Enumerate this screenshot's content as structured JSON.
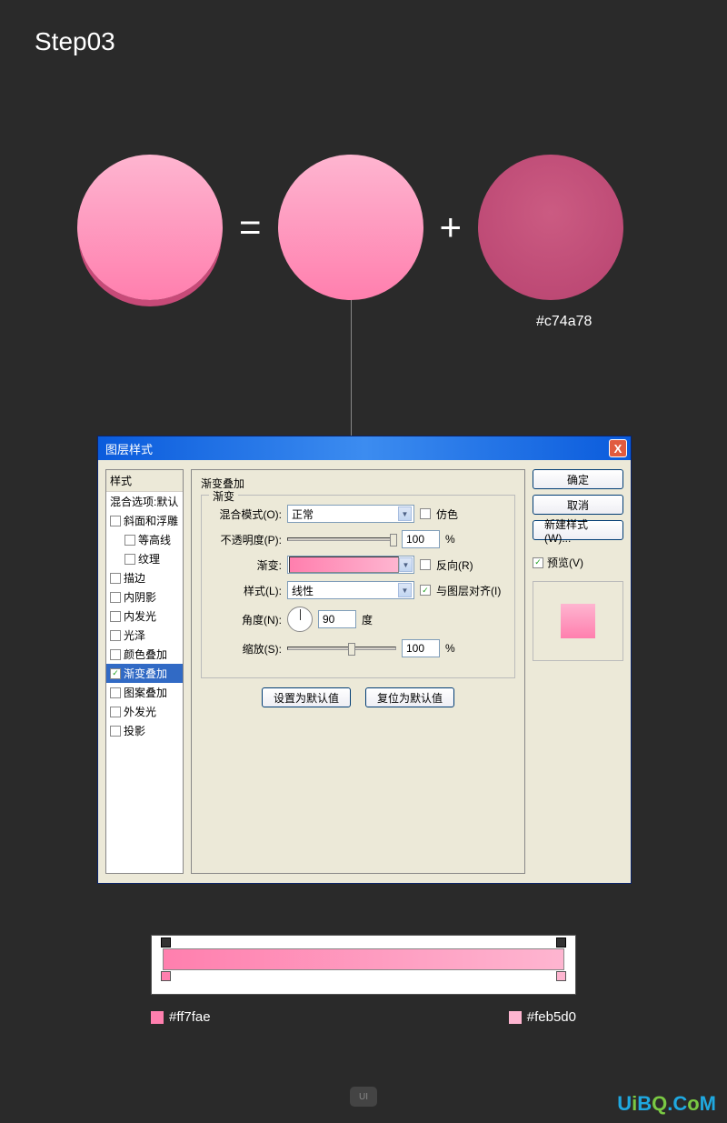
{
  "step_title": "Step03",
  "equation": {
    "equals": "=",
    "plus": "+"
  },
  "circle3_hex": "#c74a78",
  "dialog": {
    "title": "图层样式",
    "close": "X",
    "styles_header": "样式",
    "blend_options": "混合选项:默认",
    "items": [
      {
        "label": "斜面和浮雕",
        "indent": false,
        "checked": false
      },
      {
        "label": "等高线",
        "indent": true,
        "checked": false
      },
      {
        "label": "纹理",
        "indent": true,
        "checked": false
      },
      {
        "label": "描边",
        "indent": false,
        "checked": false
      },
      {
        "label": "内阴影",
        "indent": false,
        "checked": false
      },
      {
        "label": "内发光",
        "indent": false,
        "checked": false
      },
      {
        "label": "光泽",
        "indent": false,
        "checked": false
      },
      {
        "label": "颜色叠加",
        "indent": false,
        "checked": false
      },
      {
        "label": "渐变叠加",
        "indent": false,
        "checked": true,
        "selected": true
      },
      {
        "label": "图案叠加",
        "indent": false,
        "checked": false
      },
      {
        "label": "外发光",
        "indent": false,
        "checked": false
      },
      {
        "label": "投影",
        "indent": false,
        "checked": false
      }
    ],
    "group_title": "渐变叠加",
    "fieldset_label": "渐变",
    "labels": {
      "blend_mode": "混合模式(O):",
      "opacity": "不透明度(P):",
      "gradient": "渐变:",
      "style": "样式(L):",
      "angle": "角度(N):",
      "scale": "缩放(S):"
    },
    "values": {
      "blend_mode": "正常",
      "dither": "仿色",
      "opacity": "100",
      "opacity_unit": "%",
      "reverse": "反向(R)",
      "style": "线性",
      "align": "与图层对齐(I)",
      "angle": "90",
      "angle_unit": "度",
      "scale": "100",
      "scale_unit": "%"
    },
    "buttons": {
      "set_default": "设置为默认值",
      "reset_default": "复位为默认值",
      "ok": "确定",
      "cancel": "取消",
      "new_style": "新建样式(W)...",
      "preview": "预览(V)"
    }
  },
  "gradient_stops": {
    "left_hex": "#ff7fae",
    "right_hex": "#feb5d0"
  },
  "footer": {
    "ui_logo": "UI",
    "brand": {
      "u": "U",
      "i": "i",
      "b": "B",
      "q": "Q",
      ".c": ".C",
      "o": "o",
      "m": "M"
    }
  }
}
